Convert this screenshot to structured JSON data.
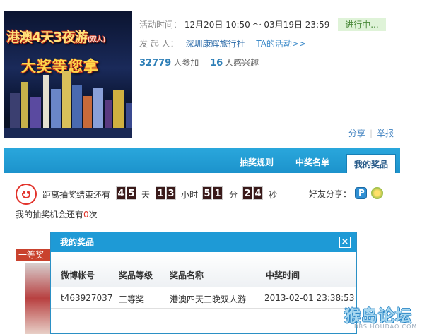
{
  "poster": {
    "title_line1": "港澳4天3夜游",
    "title_line1_suffix": "(双人)",
    "title_line2": "大奖等您拿"
  },
  "activity": {
    "time_label": "活动时间：",
    "time_value": "12月20日 10:50 ～ 03月19日 23:59",
    "status": "进行中...",
    "organizer_label": "发 起 人：",
    "organizer_name": "深圳康辉旅行社",
    "ta_activities": "TA的活动>>",
    "participants": "32779",
    "participants_label": "人参加",
    "interested": "16",
    "interested_label": "人感兴趣"
  },
  "share_bar": {
    "share": "分享",
    "report": "举报"
  },
  "tabs": [
    {
      "label": "抽奖规则"
    },
    {
      "label": "中奖名单"
    },
    {
      "label": "我的奖品",
      "active": true
    }
  ],
  "countdown": {
    "prefix": "距离抽奖结束还有",
    "days": [
      "4",
      "5"
    ],
    "day_unit": "天",
    "hours": [
      "1",
      "3"
    ],
    "hour_unit": "小时",
    "minutes": [
      "5",
      "1"
    ],
    "minute_unit": "分",
    "seconds": [
      "2",
      "4"
    ],
    "second_unit": "秒"
  },
  "friend_share": "好友分享：",
  "chances": {
    "prefix": "我的抽奖机会还有",
    "count": "0",
    "suffix": "次"
  },
  "prize_tag": "一等奖",
  "modal": {
    "title": "我的奖品",
    "close": "×",
    "columns": [
      "微博帐号",
      "奖品等级",
      "奖品名称",
      "中奖时间"
    ],
    "rows": [
      {
        "account": "t463927037",
        "level": "三等奖",
        "prize": "港澳四天三晚双人游",
        "time": "2013-02-01 23:38:53"
      }
    ]
  },
  "watermark": {
    "text": "猴岛论坛",
    "sub": "BBS.HOUDAO.COM"
  }
}
